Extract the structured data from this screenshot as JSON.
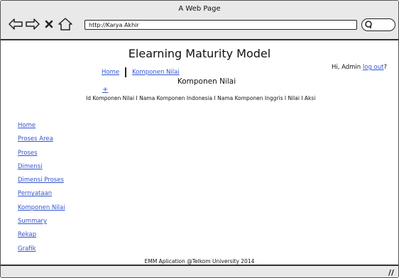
{
  "window": {
    "title": "A Web Page"
  },
  "toolbar": {
    "url": "http://Karya Akhir"
  },
  "page": {
    "title": "Elearning Maturity Model"
  },
  "user": {
    "greeting": "Hi, Admin",
    "logout": "log out",
    "suffix": "?"
  },
  "breadcrumb": [
    "Home",
    "Komponen Nilai"
  ],
  "section": {
    "title": "Komponen Nilai",
    "add_glyph": "+"
  },
  "table": {
    "header_text": "Id Komponen Nilai I  Nama Komponen Indonesia I  Nama Komponen Inggris I  Nilai I  Aksi"
  },
  "sidebar": {
    "items": [
      {
        "label": "Home"
      },
      {
        "label": "Proses Area"
      },
      {
        "label": "Proses"
      },
      {
        "label": "Dimensi"
      },
      {
        "label": "Dimensi Proses"
      },
      {
        "label": "Pernyataan"
      },
      {
        "label": "Komponen Nilai"
      },
      {
        "label": "Summary"
      },
      {
        "label": "Rekap"
      },
      {
        "label": "Grafik"
      }
    ]
  },
  "footer": {
    "text": "EMM Aplication @Telkom University 2014"
  }
}
